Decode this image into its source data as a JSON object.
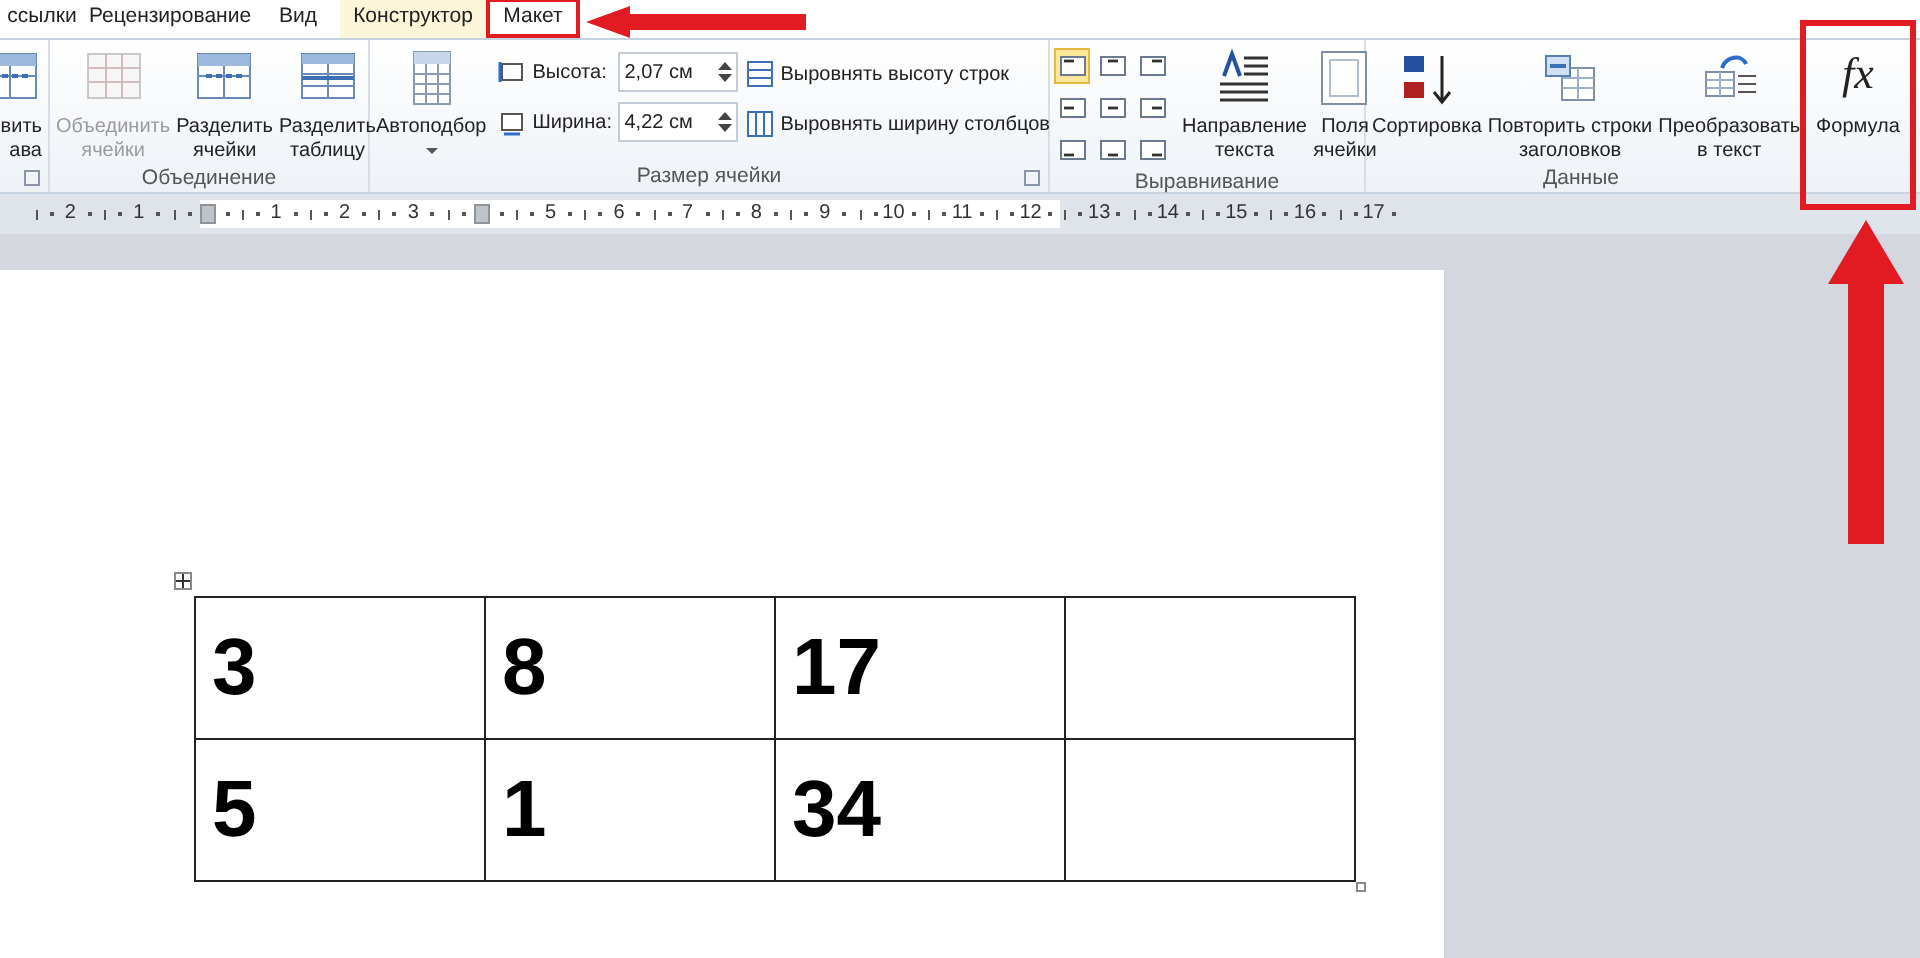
{
  "tabs": [
    {
      "label": "ссылки",
      "selected": false,
      "contextual": false
    },
    {
      "label": "Рецензирование",
      "selected": false,
      "contextual": false
    },
    {
      "label": "Вид",
      "selected": false,
      "contextual": false
    },
    {
      "label": "Конструктор",
      "selected": false,
      "contextual": true
    },
    {
      "label": "Макет",
      "selected": true,
      "contextual": true
    }
  ],
  "ribbon": {
    "groups": [
      {
        "items": [
          {
            "kind": "big",
            "label": "вить\nава",
            "disabled": false
          }
        ]
      },
      {
        "label": "Объединение",
        "items": [
          {
            "kind": "big",
            "label": "Объединить\nячейки",
            "disabled": true
          },
          {
            "kind": "big",
            "label": "Разделить\nячейки",
            "disabled": false
          },
          {
            "kind": "big",
            "label": "Разделить\nтаблицу",
            "disabled": false
          }
        ]
      },
      {
        "label": "Размер ячейки",
        "items": [
          {
            "kind": "big",
            "label": "Автоподбор",
            "disabled": false,
            "dropdown": true
          },
          {
            "kind": "fields",
            "fields": [
              {
                "label": "Высота:",
                "value": "2,07 см"
              },
              {
                "label": "Ширина:",
                "value": "4,22 см"
              }
            ]
          },
          {
            "kind": "small",
            "buttons": [
              {
                "label": "Выровнять высоту строк"
              },
              {
                "label": "Выровнять ширину столбцов"
              }
            ]
          }
        ]
      },
      {
        "label": "Выравнивание",
        "items": [
          {
            "kind": "align",
            "cells": [
              {
                "selected": true
              },
              {
                "selected": false
              },
              {
                "selected": false
              },
              {
                "selected": false
              },
              {
                "selected": false
              },
              {
                "selected": false
              },
              {
                "selected": false
              },
              {
                "selected": false
              },
              {
                "selected": false
              }
            ]
          },
          {
            "kind": "big",
            "label": "Направление\nтекста",
            "disabled": false
          },
          {
            "kind": "big",
            "label": "Поля\nячейки",
            "disabled": false
          }
        ]
      },
      {
        "label": "Данные",
        "items": [
          {
            "kind": "big",
            "label": "Сортировка",
            "disabled": false
          },
          {
            "kind": "big",
            "label": "Повторить строки\nзаголовков",
            "disabled": false
          },
          {
            "kind": "big",
            "label": "Преобразовать\nв текст",
            "disabled": false
          }
        ]
      },
      {
        "items": [
          {
            "kind": "big",
            "label": "Формула",
            "symbol": "fx",
            "disabled": false,
            "highlighted": true
          }
        ]
      }
    ]
  },
  "ruler": [
    {
      "label": "2"
    },
    {
      "label": "1"
    },
    {
      "kind": "marker"
    },
    {
      "label": "1"
    },
    {
      "label": "2"
    },
    {
      "label": "3"
    },
    {
      "kind": "marker"
    },
    {
      "label": "5"
    },
    {
      "label": "6"
    },
    {
      "label": "7"
    },
    {
      "label": "8"
    },
    {
      "label": "9"
    },
    {
      "label": "10"
    },
    {
      "label": "11"
    },
    {
      "label": "12"
    },
    {
      "label": "13"
    },
    {
      "label": "14"
    },
    {
      "label": "15"
    },
    {
      "label": "16"
    },
    {
      "label": "17"
    }
  ],
  "table": {
    "rows": [
      [
        "3",
        "8",
        "17",
        null
      ],
      [
        "5",
        "1",
        "34",
        null
      ]
    ]
  }
}
